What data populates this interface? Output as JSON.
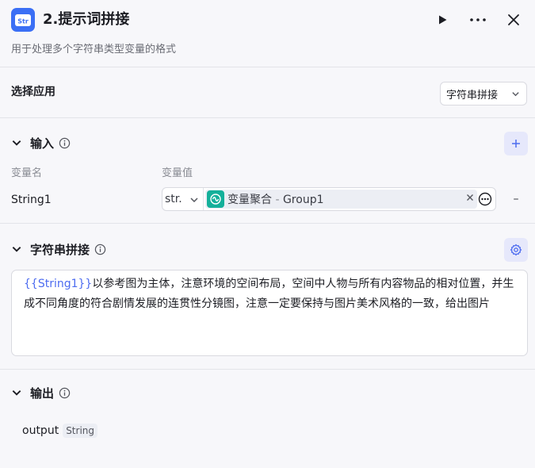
{
  "header": {
    "logo_text": "Str",
    "title": "2.提示词拼接",
    "subtitle": "用于处理多个字符串类型变量的格式"
  },
  "app_select": {
    "label": "选择应用",
    "value": "字符串拼接"
  },
  "input": {
    "title": "输入",
    "col_name": "变量名",
    "col_value": "变量值",
    "rows": [
      {
        "name": "String1",
        "type": "str.",
        "ref_source": "变量聚合",
        "ref_separator": " - ",
        "ref_var": "Group1"
      }
    ],
    "remove_label": "–"
  },
  "concat": {
    "title": "字符串拼接",
    "template_var": "{{String1}}",
    "template_text": "以参考图为主体，注意环境的空间布局，空间中人物与所有内容物品的相对位置，并生成不同角度的符合剧情发展的连贯性分镜图，注意一定要保持与图片美术风格的一致，给出图片"
  },
  "output": {
    "title": "输出",
    "name": "output",
    "type": "String"
  },
  "colors": {
    "accent": "#4d6cf0",
    "logo_bg": "#3b6ff5",
    "tag_icon_bg": "#14b09a",
    "button_bg": "#e6e8fb"
  }
}
